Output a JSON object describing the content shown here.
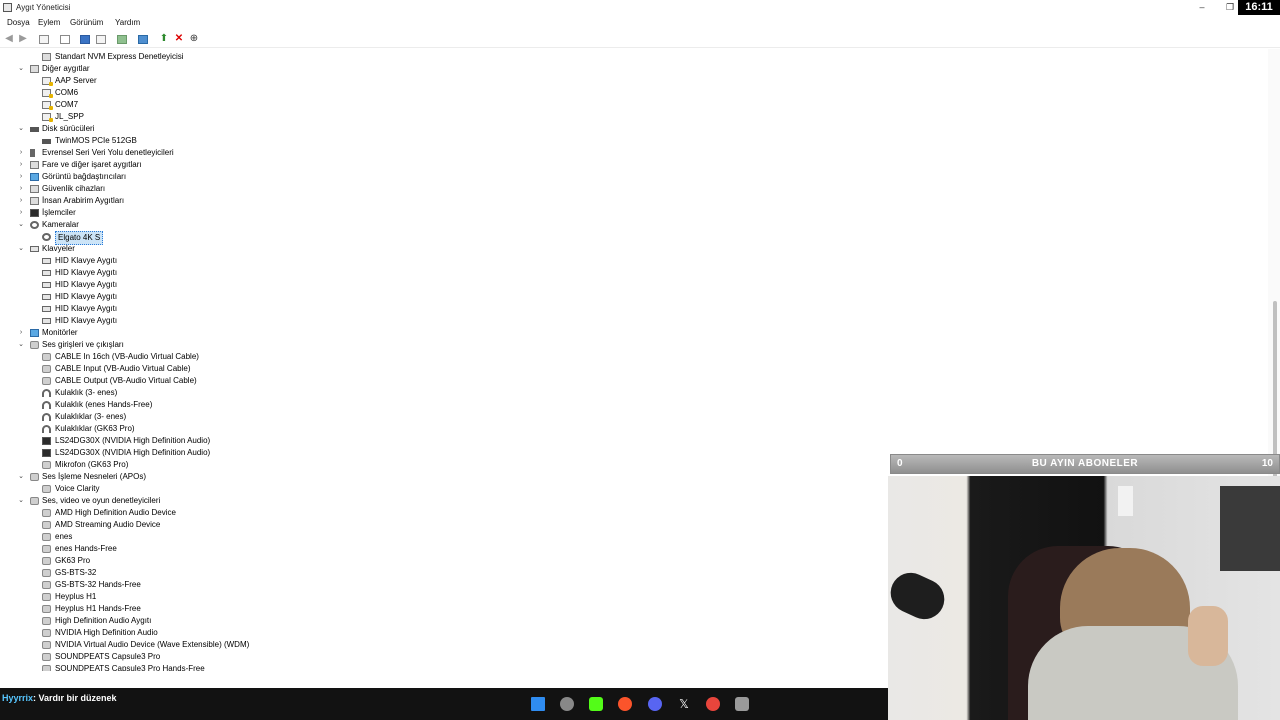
{
  "window": {
    "title": "Aygıt Yöneticisi",
    "minimize_icon": "minimize-icon",
    "restore_icon": "restore-icon",
    "clock": "16:11"
  },
  "menu": [
    "Dosya",
    "Eylem",
    "Görünüm",
    "Yardım"
  ],
  "toolbar_icons": [
    "back-arrow-icon",
    "forward-arrow-icon",
    "show-hide-tree-icon",
    "properties-icon",
    "help-icon",
    "view-icon",
    "print-icon",
    "scan-hardware-icon",
    "update-driver-icon",
    "uninstall-icon",
    "disable-device-icon"
  ],
  "tree": [
    {
      "level": 1,
      "label": "Standart NVM Express Denetleyicisi",
      "icon": "storage-controller-icon"
    },
    {
      "level": 0,
      "label": "Diğer aygıtlar",
      "expanded": true,
      "icon": "unknown-device-icon"
    },
    {
      "level": 1,
      "label": "AAP Server",
      "icon": "unknown-device-warning-icon"
    },
    {
      "level": 1,
      "label": "COM6",
      "icon": "unknown-device-warning-icon"
    },
    {
      "level": 1,
      "label": "COM7",
      "icon": "unknown-device-warning-icon"
    },
    {
      "level": 1,
      "label": "JL_SPP",
      "icon": "unknown-device-warning-icon"
    },
    {
      "level": 0,
      "label": "Disk sürücüleri",
      "expanded": true,
      "icon": "disk-drive-icon"
    },
    {
      "level": 1,
      "label": "TwinMOS PCIe 512GB",
      "icon": "disk-drive-icon"
    },
    {
      "level": 0,
      "label": "Evrensel Seri Veri Yolu denetleyicileri",
      "expanded": false,
      "icon": "usb-icon"
    },
    {
      "level": 0,
      "label": "Fare ve diğer işaret aygıtları",
      "expanded": false,
      "icon": "mouse-icon"
    },
    {
      "level": 0,
      "label": "Görüntü bağdaştırıcıları",
      "expanded": false,
      "icon": "display-adapter-icon"
    },
    {
      "level": 0,
      "label": "Güvenlik cihazları",
      "expanded": false,
      "icon": "security-device-icon"
    },
    {
      "level": 0,
      "label": "İnsan Arabirim Aygıtları",
      "expanded": false,
      "icon": "hid-icon"
    },
    {
      "level": 0,
      "label": "İşlemciler",
      "expanded": false,
      "icon": "processor-icon"
    },
    {
      "level": 0,
      "label": "Kameralar",
      "expanded": true,
      "icon": "camera-icon"
    },
    {
      "level": 1,
      "label": "Elgato 4K S",
      "icon": "camera-icon",
      "selected": true
    },
    {
      "level": 0,
      "label": "Klavyeler",
      "expanded": true,
      "icon": "keyboard-icon"
    },
    {
      "level": 1,
      "label": "HID Klavye Aygıtı",
      "icon": "keyboard-icon"
    },
    {
      "level": 1,
      "label": "HID Klavye Aygıtı",
      "icon": "keyboard-icon"
    },
    {
      "level": 1,
      "label": "HID Klavye Aygıtı",
      "icon": "keyboard-icon"
    },
    {
      "level": 1,
      "label": "HID Klavye Aygıtı",
      "icon": "keyboard-icon"
    },
    {
      "level": 1,
      "label": "HID Klavye Aygıtı",
      "icon": "keyboard-icon"
    },
    {
      "level": 1,
      "label": "HID Klavye Aygıtı",
      "icon": "keyboard-icon"
    },
    {
      "level": 0,
      "label": "Monitörler",
      "expanded": false,
      "icon": "monitor-icon"
    },
    {
      "level": 0,
      "label": "Ses girişleri ve çıkışları",
      "expanded": true,
      "icon": "speaker-icon"
    },
    {
      "level": 1,
      "label": "CABLE In 16ch (VB-Audio Virtual Cable)",
      "icon": "audio-endpoint-icon"
    },
    {
      "level": 1,
      "label": "CABLE Input (VB-Audio Virtual Cable)",
      "icon": "audio-endpoint-icon"
    },
    {
      "level": 1,
      "label": "CABLE Output (VB-Audio Virtual Cable)",
      "icon": "audio-endpoint-icon"
    },
    {
      "level": 1,
      "label": "Kulaklık (3- enes)",
      "icon": "headphones-icon"
    },
    {
      "level": 1,
      "label": "Kulaklık (enes Hands-Free)",
      "icon": "headphones-icon"
    },
    {
      "level": 1,
      "label": "Kulaklıklar (3- enes)",
      "icon": "headphones-icon"
    },
    {
      "level": 1,
      "label": "Kulaklıklar (GK63 Pro)",
      "icon": "headphones-icon"
    },
    {
      "level": 1,
      "label": "LS24DG30X (NVIDIA High Definition Audio)",
      "icon": "monitor-speaker-icon"
    },
    {
      "level": 1,
      "label": "LS24DG30X (NVIDIA High Definition Audio)",
      "icon": "monitor-speaker-icon"
    },
    {
      "level": 1,
      "label": "Mikrofon (GK63 Pro)",
      "icon": "microphone-icon"
    },
    {
      "level": 0,
      "label": "Ses İşleme Nesneleri (APOs)",
      "expanded": true,
      "icon": "speaker-icon"
    },
    {
      "level": 1,
      "label": "Voice Clarity",
      "icon": "speaker-icon"
    },
    {
      "level": 0,
      "label": "Ses, video ve oyun denetleyicileri",
      "expanded": true,
      "icon": "speaker-icon"
    },
    {
      "level": 1,
      "label": "AMD High Definition Audio Device",
      "icon": "speaker-icon"
    },
    {
      "level": 1,
      "label": "AMD Streaming Audio Device",
      "icon": "speaker-icon"
    },
    {
      "level": 1,
      "label": "enes",
      "icon": "speaker-icon"
    },
    {
      "level": 1,
      "label": "enes Hands-Free",
      "icon": "speaker-icon"
    },
    {
      "level": 1,
      "label": "GK63 Pro",
      "icon": "speaker-icon"
    },
    {
      "level": 1,
      "label": "GS-BTS-32",
      "icon": "speaker-icon"
    },
    {
      "level": 1,
      "label": "GS-BTS-32 Hands-Free",
      "icon": "speaker-icon"
    },
    {
      "level": 1,
      "label": "Heyplus H1",
      "icon": "speaker-icon"
    },
    {
      "level": 1,
      "label": "Heyplus H1 Hands-Free",
      "icon": "speaker-icon"
    },
    {
      "level": 1,
      "label": "High Definition Audio Aygıtı",
      "icon": "speaker-icon"
    },
    {
      "level": 1,
      "label": "NVIDIA High Definition Audio",
      "icon": "speaker-icon"
    },
    {
      "level": 1,
      "label": "NVIDIA Virtual Audio Device (Wave Extensible) (WDM)",
      "icon": "speaker-icon"
    },
    {
      "level": 1,
      "label": "SOUNDPEATS Capsule3 Pro",
      "icon": "speaker-icon"
    },
    {
      "level": 1,
      "label": "SOUNDPEATS Capsule3 Pro Hands-Free",
      "icon": "speaker-icon"
    }
  ],
  "overlay": {
    "left_count": "0",
    "title": "BU AYIN ABONELER",
    "right_count": "10"
  },
  "chat": {
    "user": "Hyyrrix",
    "message": ": Vardır bir düzenek"
  },
  "taskbar": [
    {
      "name": "windows-start-icon",
      "color": "#2f8cf0"
    },
    {
      "name": "app-circle-icon",
      "color": "#888888"
    },
    {
      "name": "kick-icon",
      "color": "#53fc18"
    },
    {
      "name": "brave-icon",
      "color": "#fb542b"
    },
    {
      "name": "discord-icon",
      "color": "#5865f2"
    },
    {
      "name": "x-icon",
      "color": "#ffffff"
    },
    {
      "name": "chrome-icon",
      "color": "#e8453c"
    },
    {
      "name": "device-manager-icon",
      "color": "#9a9a9a"
    }
  ]
}
